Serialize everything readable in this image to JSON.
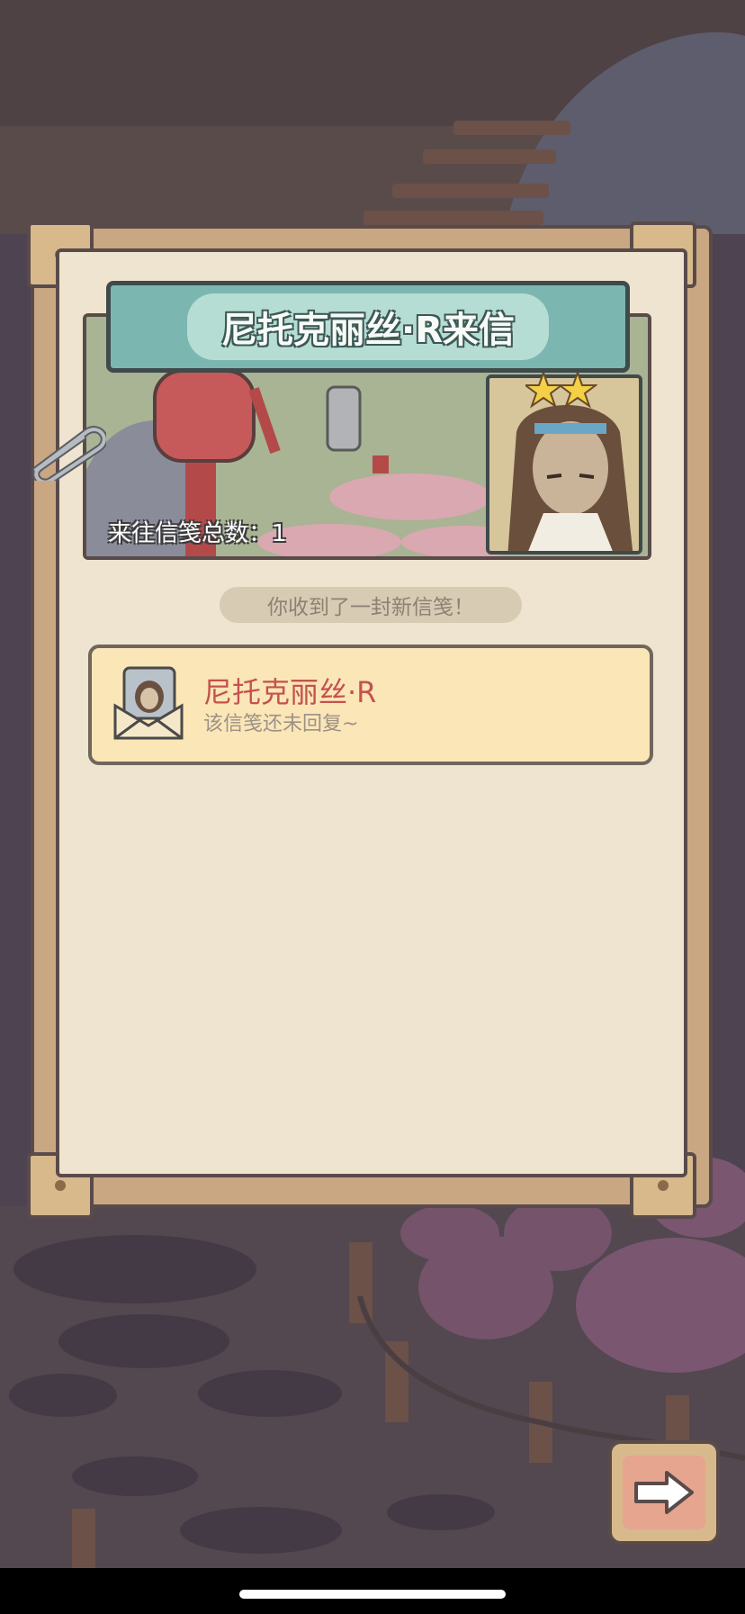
{
  "dialog": {
    "title": "尼托克丽丝·R来信",
    "total_letters_label": "来往信笺总数：1",
    "notice": "你收到了一封新信笺！"
  },
  "letter_item": {
    "sender": "尼托克丽丝·R",
    "status": "该信笺还未回复~"
  },
  "icons": {
    "envelope": "envelope-avatar-icon",
    "paperclip": "paperclip-icon",
    "next": "arrow-right-icon"
  },
  "colors": {
    "accent_teal": "#7bb7b0",
    "sender_red": "#c4524f",
    "card_bg": "#fbe6b7"
  }
}
